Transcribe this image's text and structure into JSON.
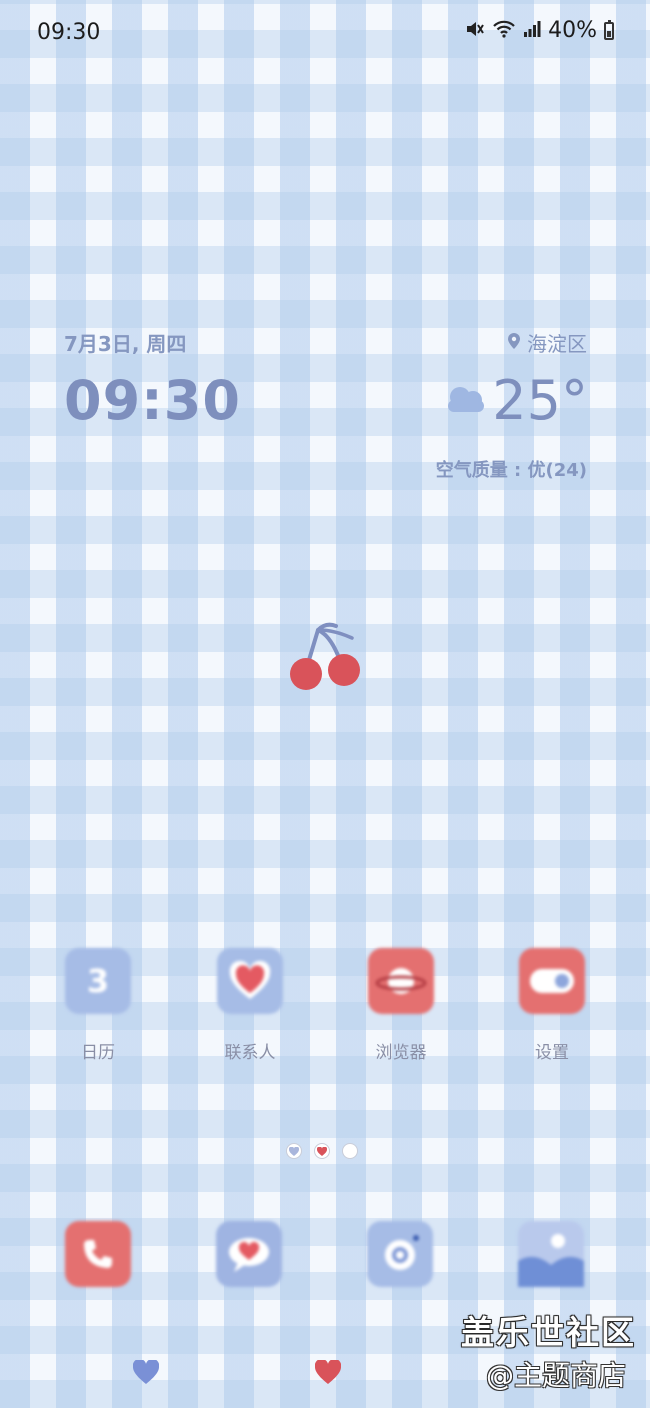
{
  "status_bar": {
    "time": "09:30",
    "battery": "40%",
    "icons": [
      "mute-icon",
      "wifi-icon",
      "signal-icon",
      "battery-icon"
    ]
  },
  "widget": {
    "date": "7月3日, 周四",
    "time": "09:30",
    "location": "海淀区",
    "temperature": "25°",
    "air_quality": "空气质量 : 优(24)",
    "weather_icon": "cloud-icon"
  },
  "apps": [
    {
      "label": "日历",
      "icon": "calendar-icon",
      "badge": "3"
    },
    {
      "label": "联系人",
      "icon": "heart-contacts-icon"
    },
    {
      "label": "浏览器",
      "icon": "planet-browser-icon"
    },
    {
      "label": "设置",
      "icon": "toggle-settings-icon"
    }
  ],
  "page_indicator": {
    "pages": 3,
    "current": 2
  },
  "dock": [
    {
      "icon": "phone-icon"
    },
    {
      "icon": "message-heart-icon"
    },
    {
      "icon": "camera-icon"
    },
    {
      "icon": "gallery-icon"
    }
  ],
  "watermark": {
    "line1": "盖乐世社区",
    "line2": "@主题商店"
  },
  "colors": {
    "widget_text": "#7e8fbd",
    "tile_blue": "#a6bce6",
    "tile_red": "#e47070"
  }
}
